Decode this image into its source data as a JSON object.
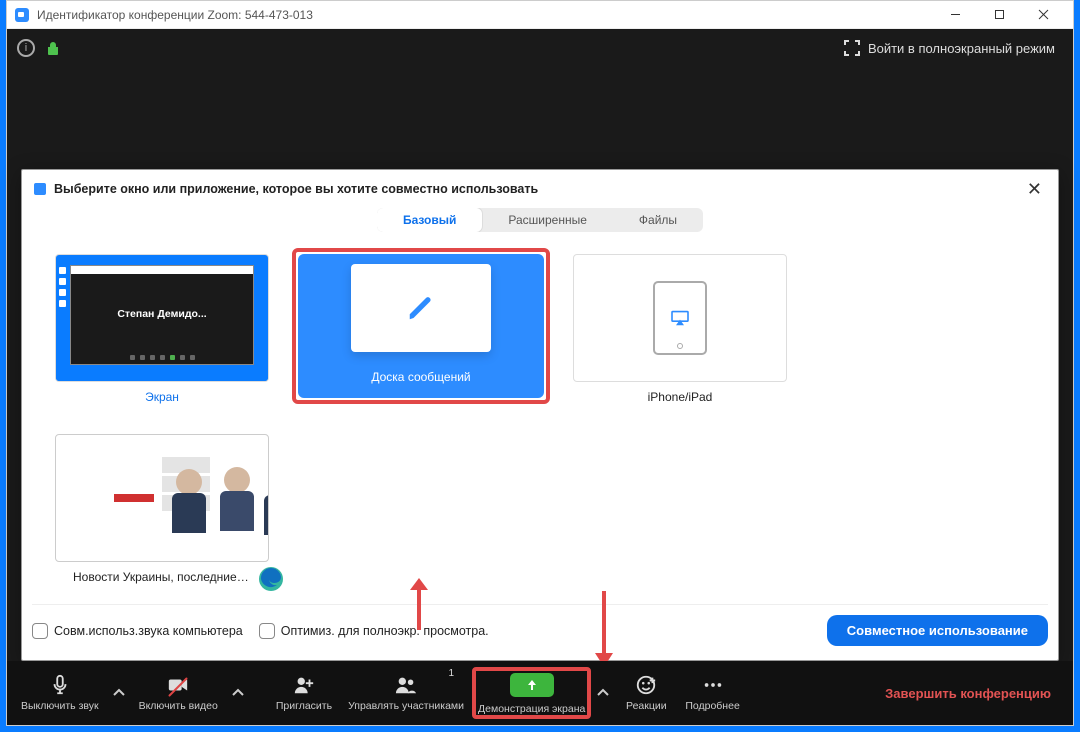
{
  "window": {
    "title": "Идентификатор конференции Zoom: 544-473-013"
  },
  "topbar": {
    "fullscreen": "Войти в полноэкранный режим"
  },
  "dialog": {
    "title": "Выберите окно или приложение, которое вы хотите совместно использовать",
    "tabs": {
      "basic": "Базовый",
      "advanced": "Расширенные",
      "files": "Файлы"
    },
    "items": {
      "screen": {
        "label": "Экран",
        "thumb_name": "Степан  Демидо..."
      },
      "whiteboard": {
        "label": "Доска сообщений"
      },
      "iphone_ipad": {
        "label": "iPhone/iPad"
      },
      "edge": {
        "label": "Новости Украины, последние н..."
      }
    },
    "options": {
      "share_audio": "Совм.использ.звука компьютера",
      "optimize_video": "Оптимиз. для полноэкр. просмотра."
    },
    "share_button": "Совместное использование"
  },
  "toolbar": {
    "mute": "Выключить звук",
    "video": "Включить видео",
    "invite": "Пригласить",
    "participants": "Управлять участниками",
    "participants_count": "1",
    "share": "Демонстрация экрана",
    "reactions": "Реакции",
    "more": "Подробнее",
    "end": "Завершить конференцию"
  }
}
